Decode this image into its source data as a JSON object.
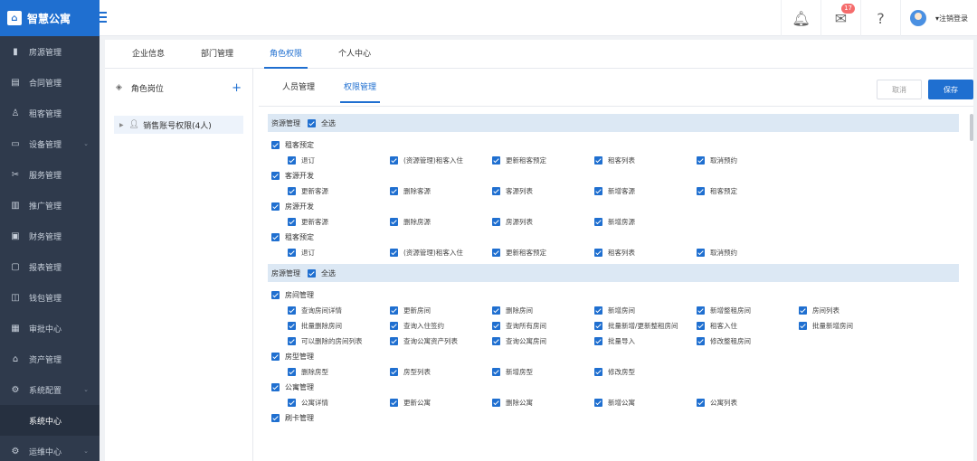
{
  "app": {
    "title": "智慧公寓"
  },
  "sidebar": {
    "items": [
      {
        "label": "房源管理",
        "icon": "building-icon",
        "glyph": "▮"
      },
      {
        "label": "合同管理",
        "icon": "contract-icon",
        "glyph": "▤"
      },
      {
        "label": "租客管理",
        "icon": "tenant-icon",
        "glyph": "♙"
      },
      {
        "label": "设备管理",
        "icon": "device-icon",
        "glyph": "▭",
        "chevron": true
      },
      {
        "label": "服务管理",
        "icon": "service-icon",
        "glyph": "✂"
      },
      {
        "label": "推广管理",
        "icon": "promo-icon",
        "glyph": "▥"
      },
      {
        "label": "财务管理",
        "icon": "finance-icon",
        "glyph": "▣"
      },
      {
        "label": "报表管理",
        "icon": "report-icon",
        "glyph": "▢"
      },
      {
        "label": "钱包管理",
        "icon": "wallet-icon",
        "glyph": "◫"
      },
      {
        "label": "审批中心",
        "icon": "approval-icon",
        "glyph": "▦"
      },
      {
        "label": "资产管理",
        "icon": "asset-icon",
        "glyph": "⌂"
      },
      {
        "label": "系统配置",
        "icon": "settings-icon",
        "glyph": "⚙",
        "chevron": true
      },
      {
        "label": "系统中心",
        "sub": true
      },
      {
        "label": "运维中心",
        "icon": "ops-icon",
        "glyph": "⚙",
        "chevron": true
      }
    ]
  },
  "topbar": {
    "mail_badge": "17",
    "logout": "▾注销登录"
  },
  "main_tabs": [
    {
      "label": "企业信息"
    },
    {
      "label": "部门管理"
    },
    {
      "label": "角色权限",
      "active": true
    },
    {
      "label": "个人中心"
    }
  ],
  "role_panel": {
    "title": "角色岗位",
    "roles": [
      {
        "label": "销售账号权限(4人)"
      }
    ]
  },
  "sub_tabs": [
    {
      "label": "人员管理"
    },
    {
      "label": "权限管理",
      "active": true
    }
  ],
  "buttons": {
    "cancel": "取消",
    "save": "保存"
  },
  "sections": [
    {
      "title": "资源管理",
      "select_all": "全选",
      "groups": [
        {
          "label": "租客预定",
          "rows": [
            [
              "退订",
              "(资源管理)租客入住",
              "更新租客预定",
              "租客列表",
              "取消预约"
            ]
          ]
        },
        {
          "label": "客源开发",
          "rows": [
            [
              "更新客源",
              "删除客源",
              "客源列表",
              "新增客源",
              "租客预定"
            ]
          ]
        },
        {
          "label": "房源开发",
          "rows": [
            [
              "更新客源",
              "删除房源",
              "房源列表",
              "新增房源"
            ]
          ]
        },
        {
          "label": "租客预定",
          "rows": [
            [
              "退订",
              "(资源管理)租客入住",
              "更新租客预定",
              "租客列表",
              "取消预约"
            ]
          ]
        }
      ]
    },
    {
      "title": "房源管理",
      "select_all": "全选",
      "groups": [
        {
          "label": "房间管理",
          "rows": [
            [
              "查询房间详情",
              "更新房间",
              "删除房间",
              "新增房间",
              "新增整租房间",
              "房间列表"
            ],
            [
              "批量删除房间",
              "查询入住签约",
              "查询所有房间",
              "批量新增/更新整租房间",
              "租客入住",
              "批量新增房间"
            ],
            [
              "可以删除的房间列表",
              "查询公寓资产列表",
              "查询公寓房间",
              "批量导入",
              "修改整租房间"
            ]
          ]
        },
        {
          "label": "房型管理",
          "rows": [
            [
              "删除房型",
              "房型列表",
              "新增房型",
              "修改房型"
            ]
          ]
        },
        {
          "label": "公寓管理",
          "rows": [
            [
              "公寓详情",
              "更新公寓",
              "删除公寓",
              "新增公寓",
              "公寓列表"
            ]
          ]
        },
        {
          "label": "刷卡管理",
          "rows": []
        }
      ]
    }
  ]
}
